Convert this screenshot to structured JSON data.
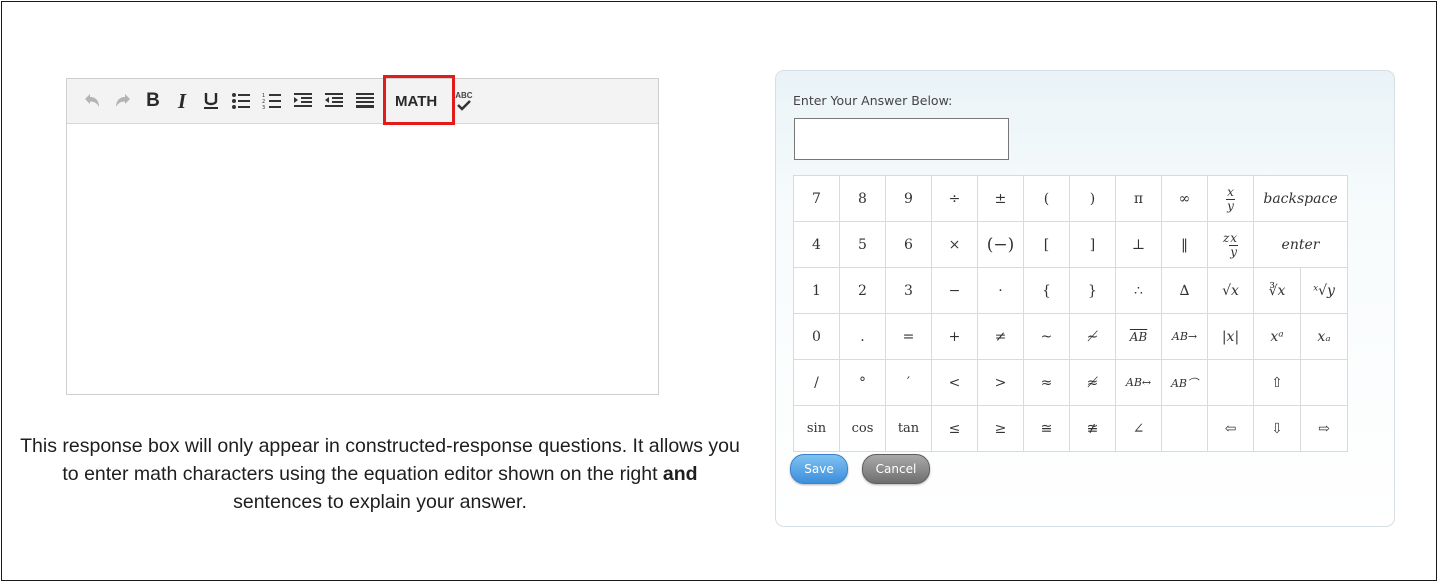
{
  "editor": {
    "math_label": "MATH",
    "spellcheck_label": "ABC"
  },
  "description": {
    "part1": "This response box will only appear in constructed-response questions. It allows you to enter math characters using the equation editor shown on the right ",
    "bold": "and",
    "part2": " sentences to explain your answer."
  },
  "keypad": {
    "label": "Enter Your Answer Below:",
    "input_value": "",
    "rows": [
      [
        "7",
        "8",
        "9",
        "÷",
        "±",
        "(",
        ")",
        "π",
        "∞",
        "x/y",
        "backspace"
      ],
      [
        "4",
        "5",
        "6",
        "×",
        "(−)",
        "[",
        "]",
        "⊥",
        "‖",
        "z x/y",
        "enter"
      ],
      [
        "1",
        "2",
        "3",
        "−",
        "·",
        "{",
        "}",
        "∴",
        "∆",
        "√x",
        "∛x",
        "ˣ√y"
      ],
      [
        "0",
        ".",
        "=",
        "+",
        "≠",
        "~",
        "≁",
        "AB",
        "AB→",
        "|x|",
        "xᵃ",
        "xₐ"
      ],
      [
        "/",
        "°",
        "′",
        "<",
        ">",
        "≈",
        "≉",
        "AB↔",
        "AB⌒",
        "",
        "⇧",
        ""
      ],
      [
        "sin",
        "cos",
        "tan",
        "≤",
        "≥",
        "≅",
        "≇",
        "∠",
        "",
        "⇦",
        "⇩",
        "⇨"
      ]
    ],
    "save_label": "Save",
    "cancel_label": "Cancel"
  }
}
